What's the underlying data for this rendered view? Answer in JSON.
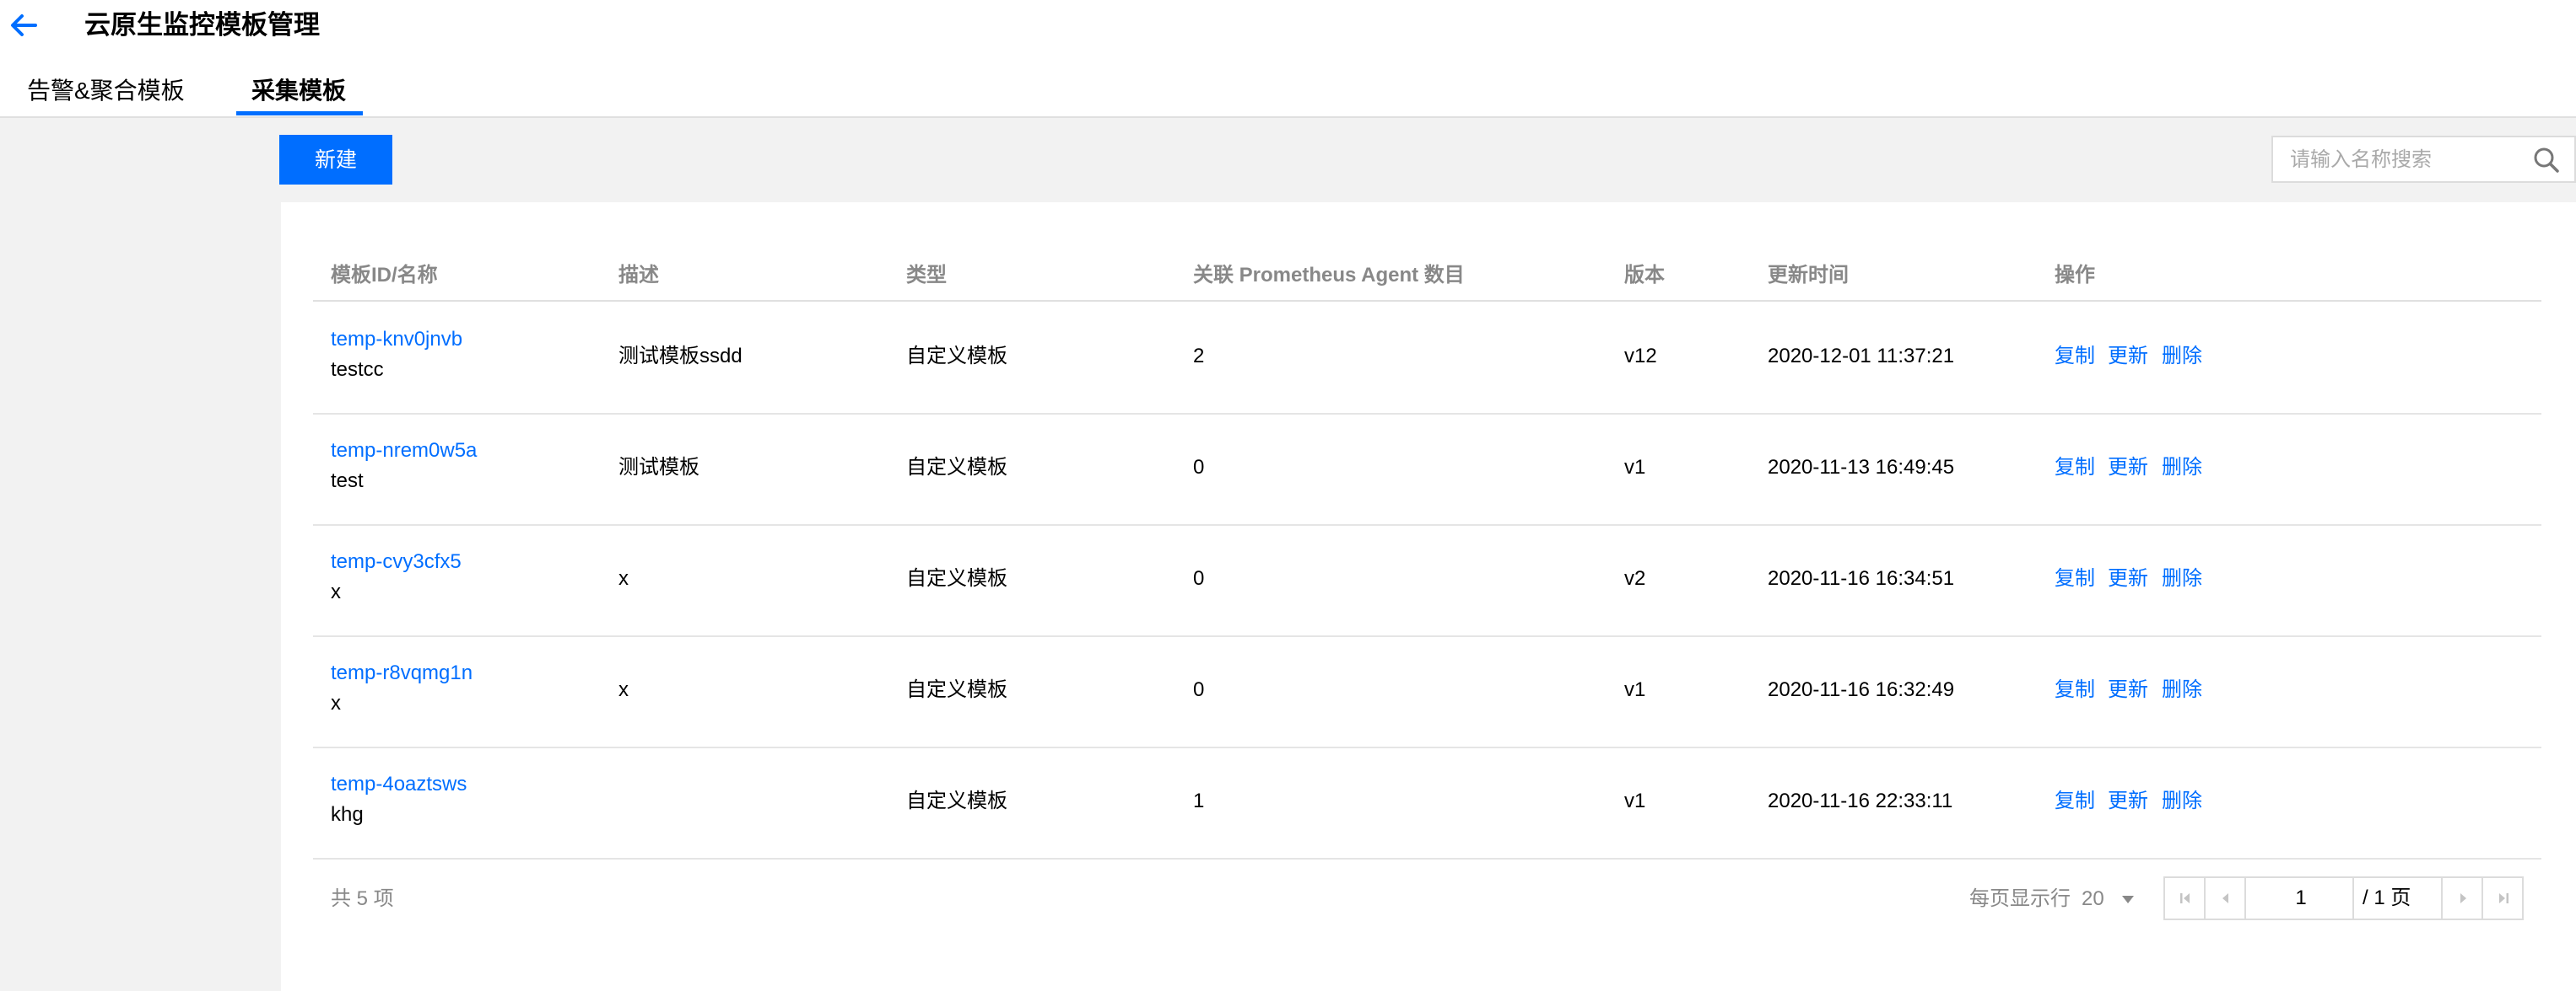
{
  "header": {
    "title": "云原生监控模板管理",
    "tabs": [
      {
        "label": "告警&聚合模板",
        "active": false
      },
      {
        "label": "采集模板",
        "active": true
      }
    ]
  },
  "toolbar": {
    "new_label": "新建",
    "search_placeholder": "请输入名称搜索"
  },
  "table": {
    "columns": [
      "模板ID/名称",
      "描述",
      "类型",
      "关联 Prometheus Agent 数目",
      "版本",
      "更新时间",
      "操作"
    ],
    "rows": [
      {
        "id": "temp-knv0jnvb",
        "name": "testcc",
        "desc": "测试模板ssdd",
        "type": "自定义模板",
        "agents": "2",
        "version": "v12",
        "updated": "2020-12-01 11:37:21"
      },
      {
        "id": "temp-nrem0w5a",
        "name": "test",
        "desc": "测试模板",
        "type": "自定义模板",
        "agents": "0",
        "version": "v1",
        "updated": "2020-11-13 16:49:45"
      },
      {
        "id": "temp-cvy3cfx5",
        "name": "x",
        "desc": "x",
        "type": "自定义模板",
        "agents": "0",
        "version": "v2",
        "updated": "2020-11-16 16:34:51"
      },
      {
        "id": "temp-r8vqmg1n",
        "name": "x",
        "desc": "x",
        "type": "自定义模板",
        "agents": "0",
        "version": "v1",
        "updated": "2020-11-16 16:32:49"
      },
      {
        "id": "temp-4oaztsws",
        "name": "khg",
        "desc": "",
        "type": "自定义模板",
        "agents": "1",
        "version": "v1",
        "updated": "2020-11-16 22:33:11"
      }
    ],
    "actions": [
      "复制",
      "更新",
      "删除"
    ]
  },
  "footer": {
    "total_text": "共 5 项",
    "per_page_label": "每页显示行",
    "page_size": "20",
    "current_page": "1",
    "page_total_text": "/ 1 页"
  },
  "colors": {
    "accent": "#006eff",
    "background": "#f2f2f2",
    "muted_text": "#888888"
  },
  "icons": [
    "arrow-left-icon",
    "search-icon",
    "chevron-down-icon",
    "first-page-icon",
    "prev-page-icon",
    "next-page-icon",
    "last-page-icon"
  ]
}
